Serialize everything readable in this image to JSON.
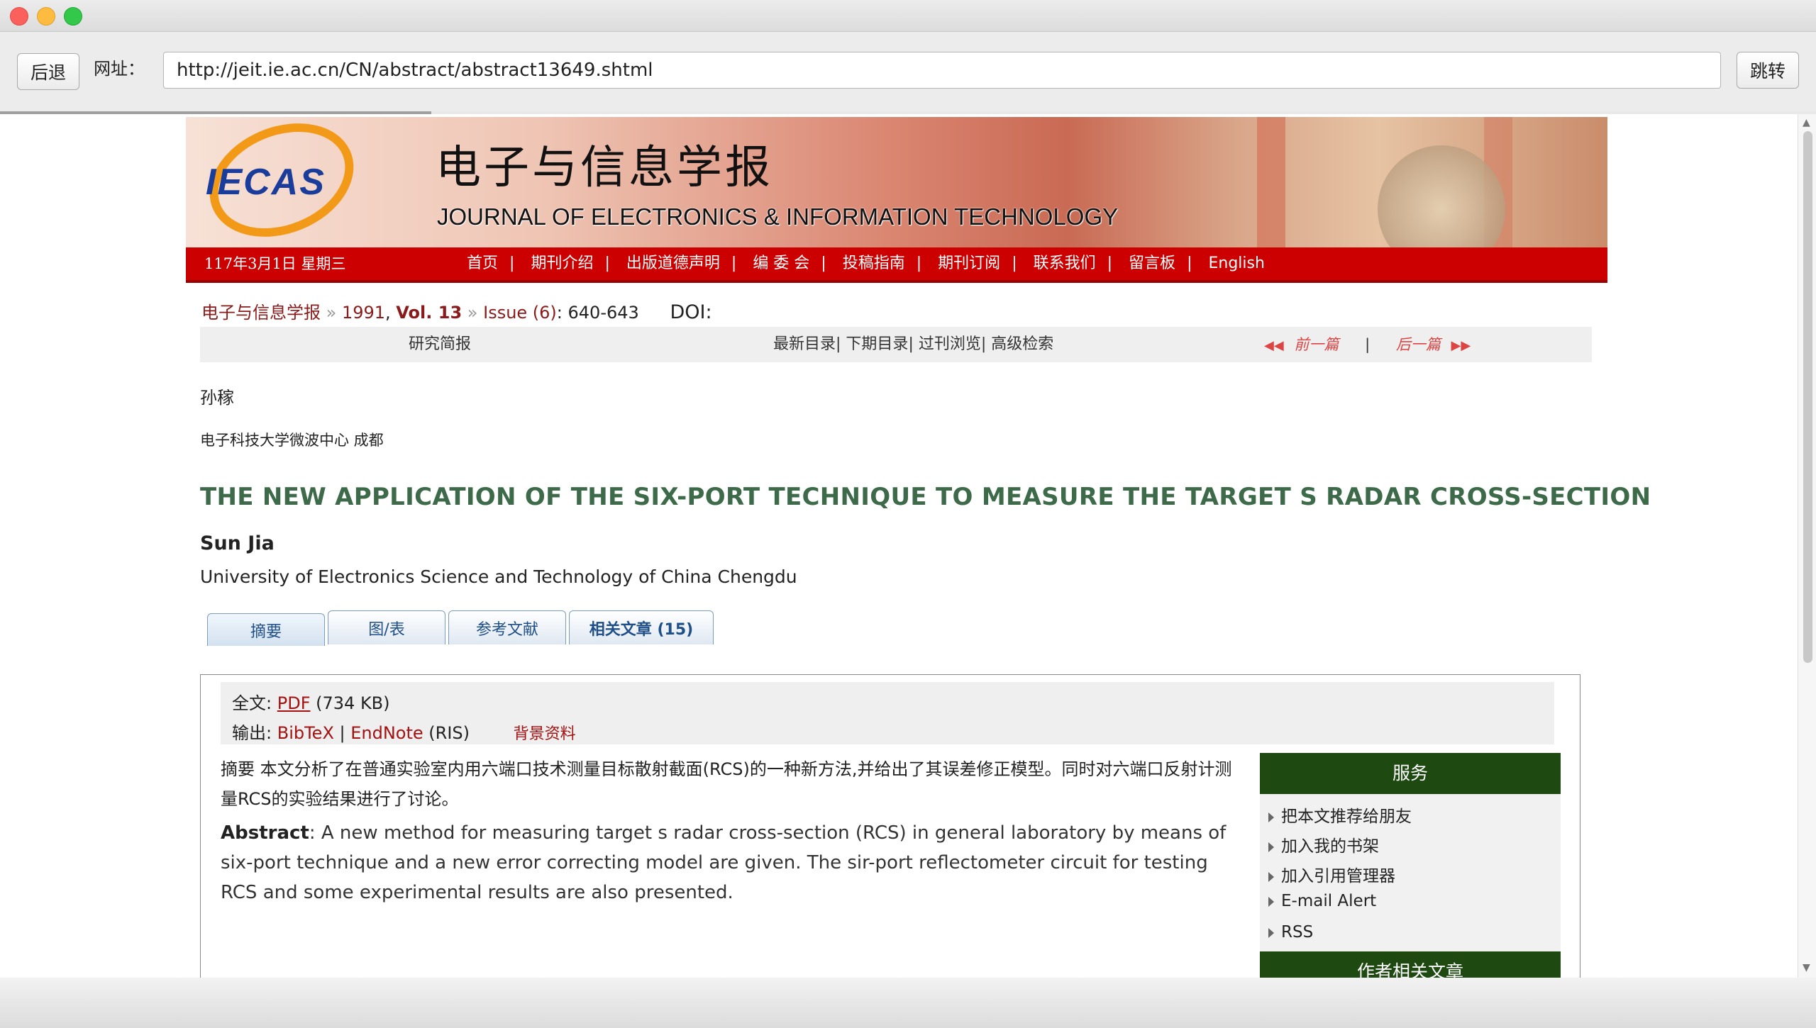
{
  "browser": {
    "back_label": "后退",
    "url_label": "网址：",
    "url": "http://jeit.ie.ac.cn/CN/abstract/abstract13649.shtml",
    "go_label": "跳转"
  },
  "site": {
    "logo_text": "IECAS",
    "title_cn": "电子与信息学报",
    "title_en": "JOURNAL OF ELECTRONICS & INFORMATION TECHNOLOGY",
    "date": "117年3月1日 星期三",
    "nav": [
      "首页",
      "期刊介绍",
      "出版道德声明",
      "编 委 会",
      "投稿指南",
      "期刊订阅",
      "联系我们",
      "留言板",
      "English"
    ]
  },
  "breadcrumb": {
    "journal": "电子与信息学报",
    "year": "1991",
    "vol": "Vol. 13",
    "issue": "Issue (6)",
    "pages": ": 640-643",
    "doi": "DOI:"
  },
  "subbar": {
    "section": "研究简报",
    "links": [
      "最新目录",
      "下期目录",
      "过刊浏览",
      "高级检索"
    ],
    "prev": "前一篇",
    "next": "后一篇"
  },
  "article": {
    "author_cn": "孙稼",
    "affiliation_cn": "电子科技大学微波中心 成都",
    "title_en": "THE NEW APPLICATION OF THE SIX-PORT TECHNIQUE TO MEASURE THE TARGET S RADAR CROSS-SECTION",
    "author_en": "Sun Jia",
    "affiliation_en": "University of Electronics Science and Technology of China Chengdu"
  },
  "tabs": [
    "摘要",
    "图/表",
    "参考文献",
    "相关文章 (15)"
  ],
  "fulltext": {
    "label": "全文:",
    "pdf": "PDF",
    "size": "(734 KB)",
    "export_label": "输出:",
    "bibtex": "BibTeX",
    "endnote": "EndNote",
    "ris": "(RIS)",
    "background": "背景资料"
  },
  "abstract": {
    "cn_label": "摘要",
    "cn_text": "本文分析了在普通实验室内用六端口技术测量目标散射截面(RCS)的一种新方法,并给出了其误差修正模型。同时对六端口反射计测量RCS的实验结果进行了讨论。",
    "en_label": "Abstract",
    "en_text": ": A new method for measuring target s radar cross-section (RCS) in general laboratory by means of six-port technique and a new error correcting model are given. The sir-port reflectometer circuit for testing RCS and some experimental results are also presented."
  },
  "services": {
    "heading": "服务",
    "items": [
      "把本文推荐给朋友",
      "加入我的书架",
      "加入引用管理器",
      "E-mail Alert",
      "RSS"
    ],
    "heading2": "作者相关文章"
  }
}
